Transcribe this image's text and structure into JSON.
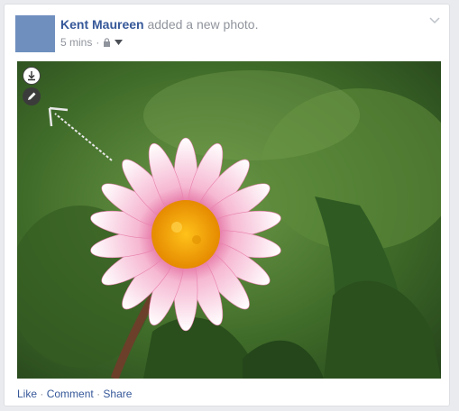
{
  "post": {
    "author": "Kent Maureen",
    "action_text": "added a new photo.",
    "time": "5 mins",
    "meta_separator": "·",
    "privacy_icon": "lock-icon",
    "audience_icon": "caret-down-icon",
    "options_icon": "chevron-down-icon"
  },
  "photo": {
    "subject": "pink daisy flower",
    "download_icon": "download-icon",
    "edit_icon": "pencil-icon"
  },
  "actions": {
    "like": "Like",
    "comment": "Comment",
    "share": "Share",
    "separator": "·"
  },
  "colors": {
    "link": "#365899",
    "muted": "#90949c",
    "background": "#e9ebee",
    "card": "#ffffff"
  }
}
